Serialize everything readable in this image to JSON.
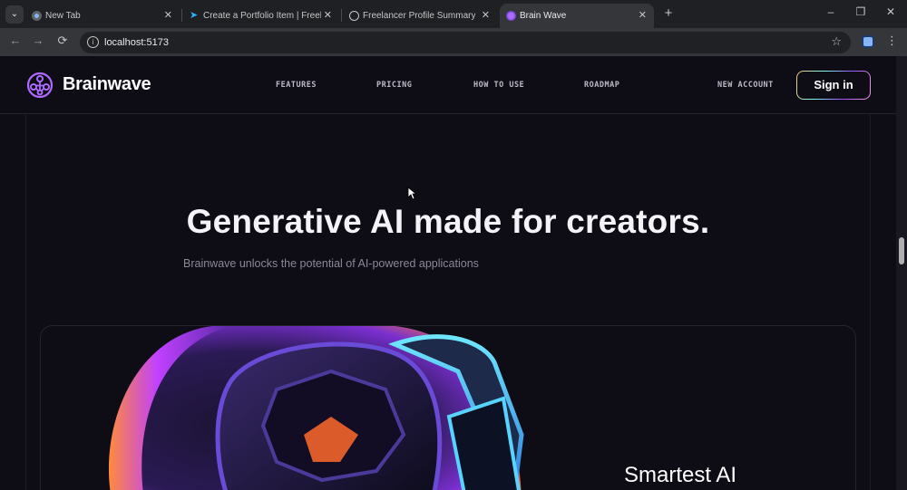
{
  "browser": {
    "tabs": [
      {
        "title": "New Tab",
        "active": false,
        "favicon": "chrome-icon"
      },
      {
        "title": "Create a Portfolio Item | Freelan",
        "active": false,
        "favicon": "freelancer-icon"
      },
      {
        "title": "Freelancer Profile Summary",
        "active": false,
        "favicon": "openai-icon"
      },
      {
        "title": "Brain Wave",
        "active": true,
        "favicon": "brainwave-icon"
      }
    ],
    "new_tab_label": "+",
    "url": "localhost:5173",
    "window_controls": {
      "minimize": "–",
      "restore": "❐",
      "close": "✕"
    }
  },
  "site": {
    "brand": "Brainwave",
    "nav": [
      "FEATURES",
      "PRICING",
      "HOW TO USE",
      "ROADMAP"
    ],
    "new_account": "NEW ACCOUNT",
    "sign_in": "Sign in",
    "hero": {
      "title": "Generative AI made for creators.",
      "subtitle": "Brainwave unlocks the potential of AI-powered applications"
    },
    "card": {
      "heading": "Smartest AI"
    }
  },
  "colors": {
    "page_bg": "#0e0c15",
    "brand_purple": "#ac6aff",
    "button_gradient": [
      "#ffc876",
      "#79fff7",
      "#9f53ff",
      "#ff98e2"
    ]
  }
}
